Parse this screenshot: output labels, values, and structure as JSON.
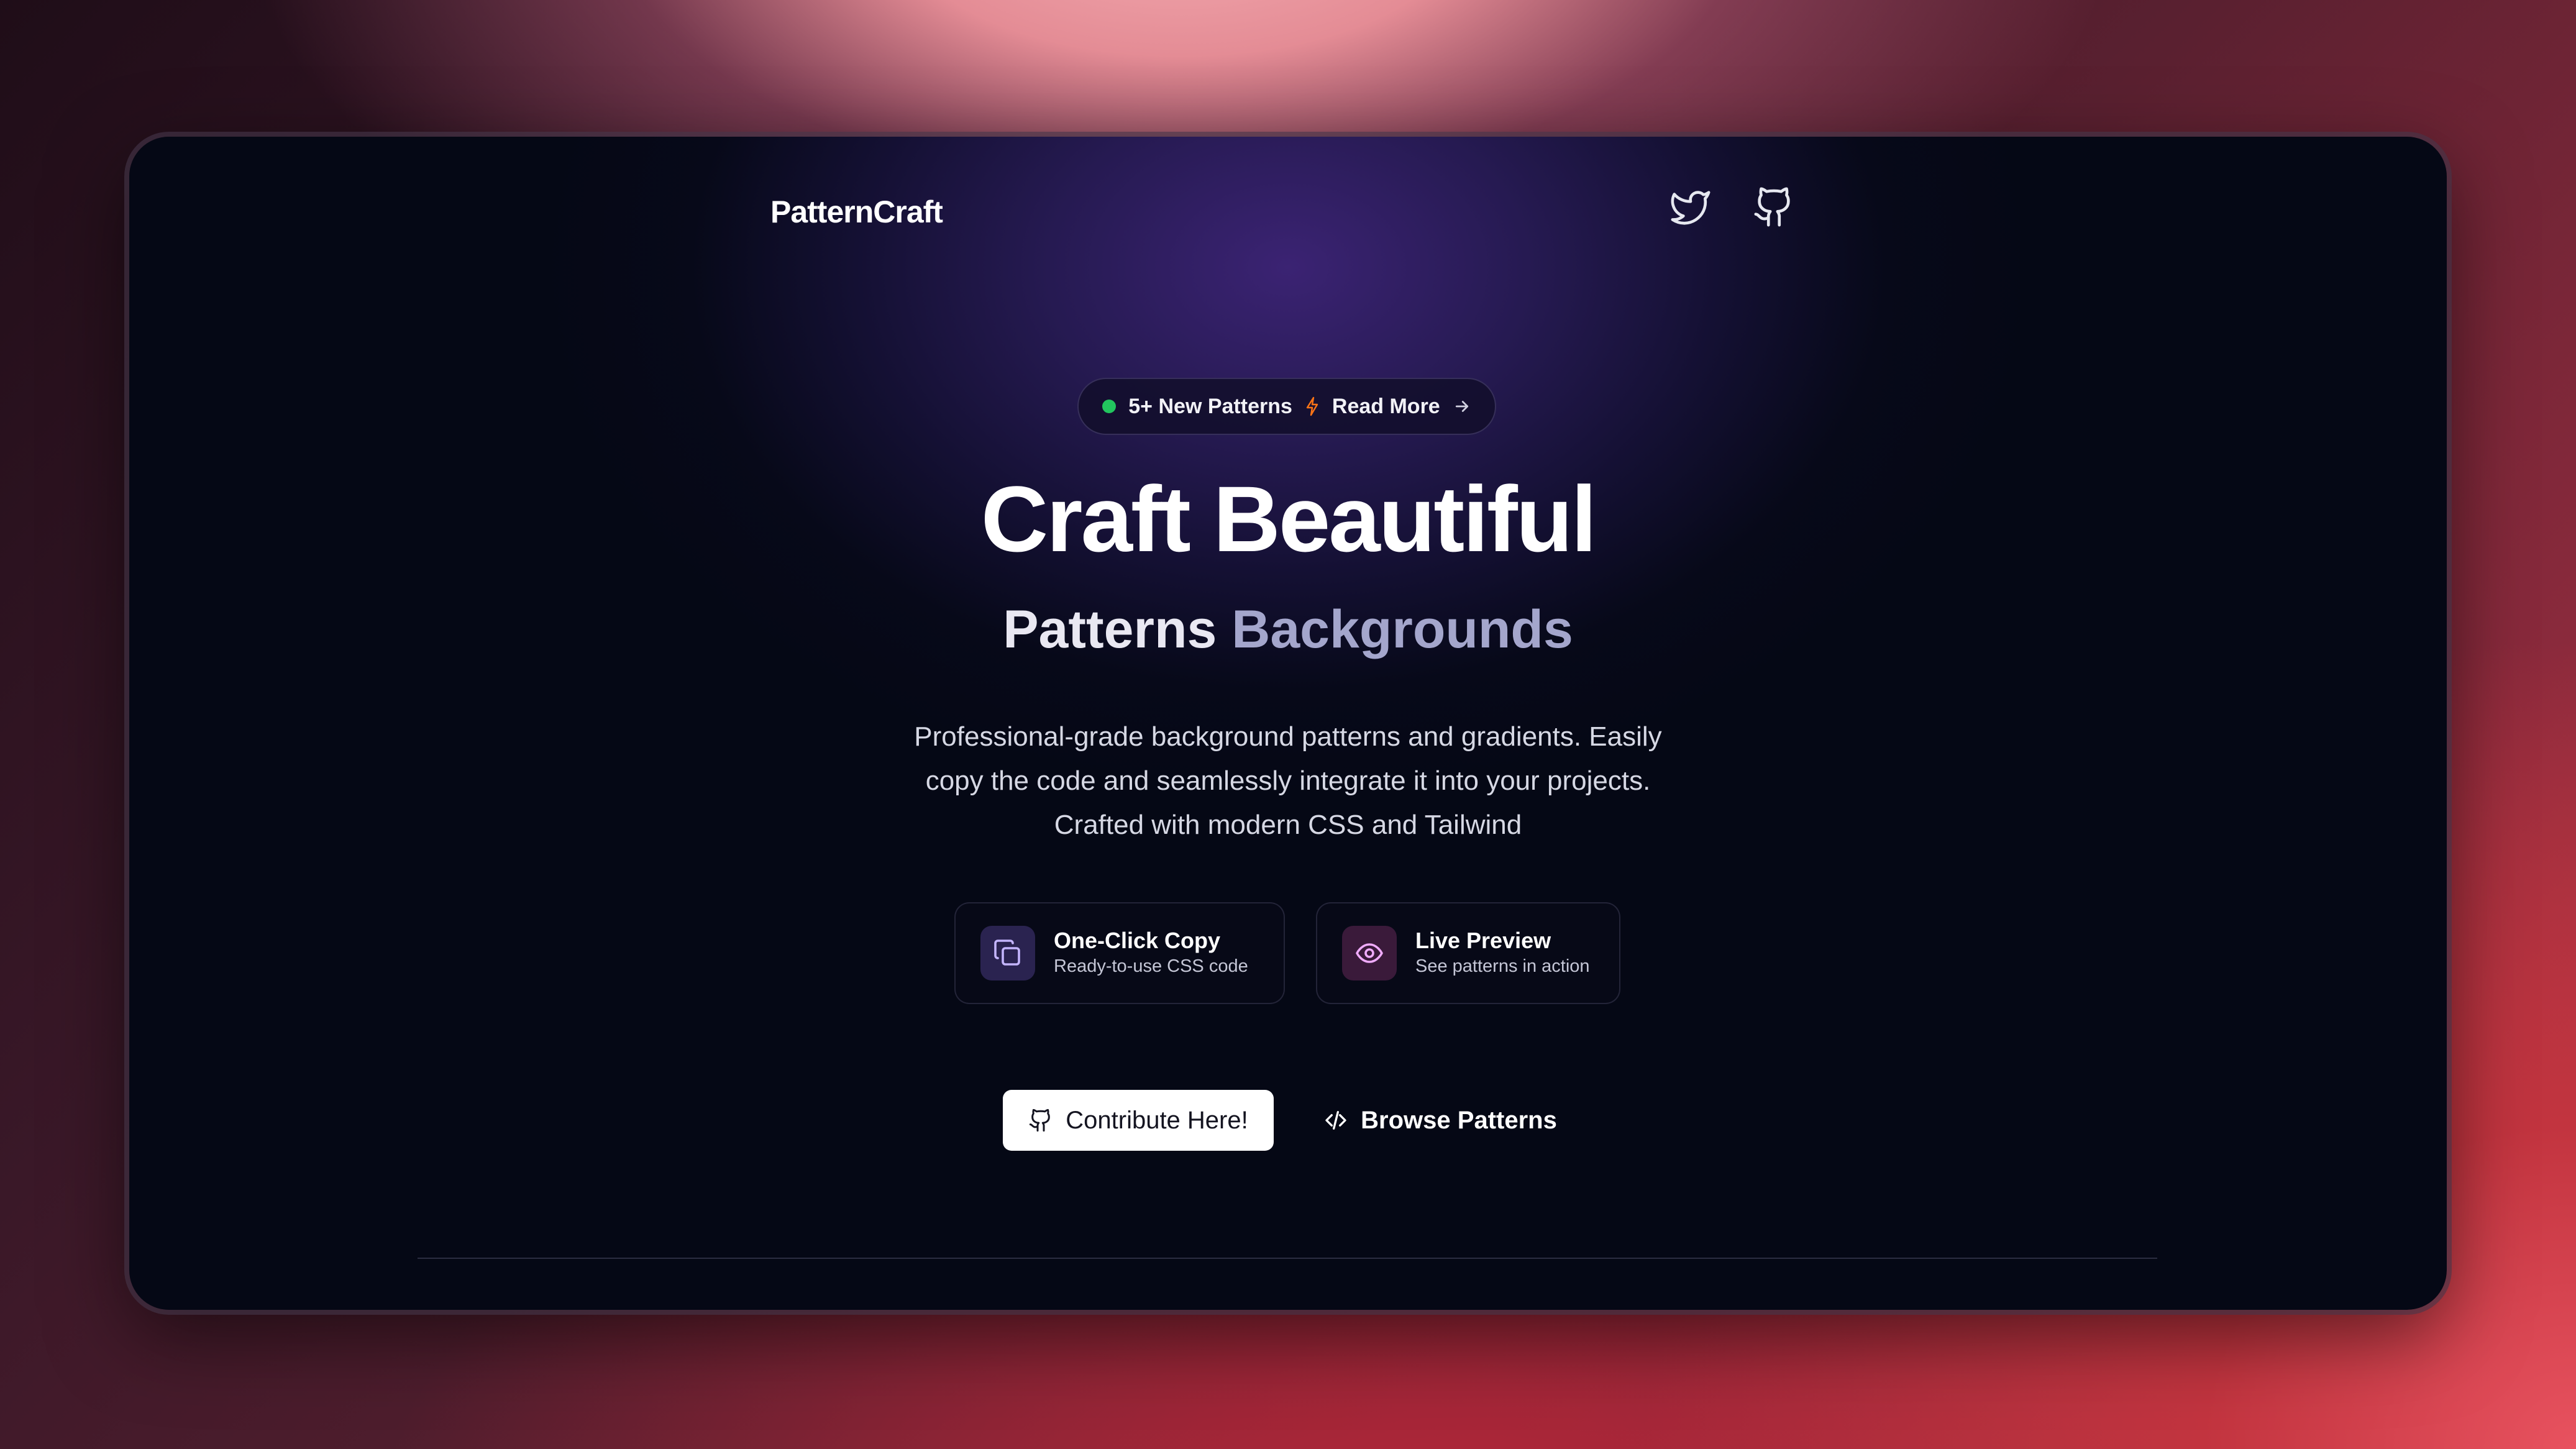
{
  "nav": {
    "logo": "PatternCraft",
    "icons": [
      "twitter-icon",
      "github-icon"
    ]
  },
  "announcement": {
    "new_patterns": "5+ New Patterns",
    "read_more": "Read More",
    "dot_color": "#22c55e",
    "bolt_color": "#f97316"
  },
  "hero": {
    "title": "Craft Beautiful",
    "subtitle_word1": "Patterns",
    "subtitle_word2": "Backgrounds",
    "description_lines": [
      "Professional-grade background patterns and gradients. Easily",
      "copy the code and seamlessly integrate it into your projects.",
      "Crafted with modern CSS and Tailwind"
    ]
  },
  "features": [
    {
      "title": "One-Click Copy",
      "subtitle": "Ready-to-use CSS code",
      "icon": "copy-icon"
    },
    {
      "title": "Live Preview",
      "subtitle": "See patterns in action",
      "icon": "eye-icon"
    }
  ],
  "actions": {
    "contribute_label": "Contribute Here!",
    "browse_label": "Browse Patterns"
  },
  "colors": {
    "primary_button_bg": "#ffffff",
    "window_bg": "#050815",
    "accent_glow": "#3b2373"
  }
}
